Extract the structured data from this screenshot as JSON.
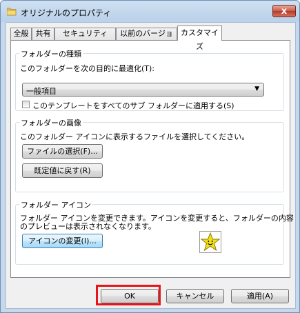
{
  "window": {
    "title": "オリジナルのプロパティ",
    "close_glyph": "x"
  },
  "tabs": [
    "全般",
    "共有",
    "セキュリティ",
    "以前のバージョン",
    "カスタマイズ"
  ],
  "active_tab": "カスタマイズ",
  "folder_type": {
    "group_label": "フォルダーの種類",
    "description": "このフォルダーを次の目的に最適化(T):",
    "select_value": "一般項目",
    "apply_subfolders_label": "このテンプレートをすべてのサブ フォルダーに適用する(S)",
    "apply_subfolders_checked": false
  },
  "folder_picture": {
    "group_label": "フォルダーの画像",
    "description": "このフォルダー アイコンに表示するファイルを選択してください。",
    "choose_file_label": "ファイルの選択(F)...",
    "restore_default_label": "既定値に戻す(R)"
  },
  "folder_icon": {
    "group_label": "フォルダー アイコン",
    "description_line1": "フォルダー アイコンを変更できます。アイコンを変更すると、フォルダーの内容",
    "description_line2": "のプレビューは表示されなくなります。",
    "change_icon_label": "アイコンの変更(I)...",
    "preview_icon": "smiley-star-icon"
  },
  "footer": {
    "ok_label": "OK",
    "cancel_label": "キャンセル",
    "apply_label": "適用(A)"
  },
  "colors": {
    "highlight": "#e8141a",
    "accent": "#3c7fb1"
  }
}
